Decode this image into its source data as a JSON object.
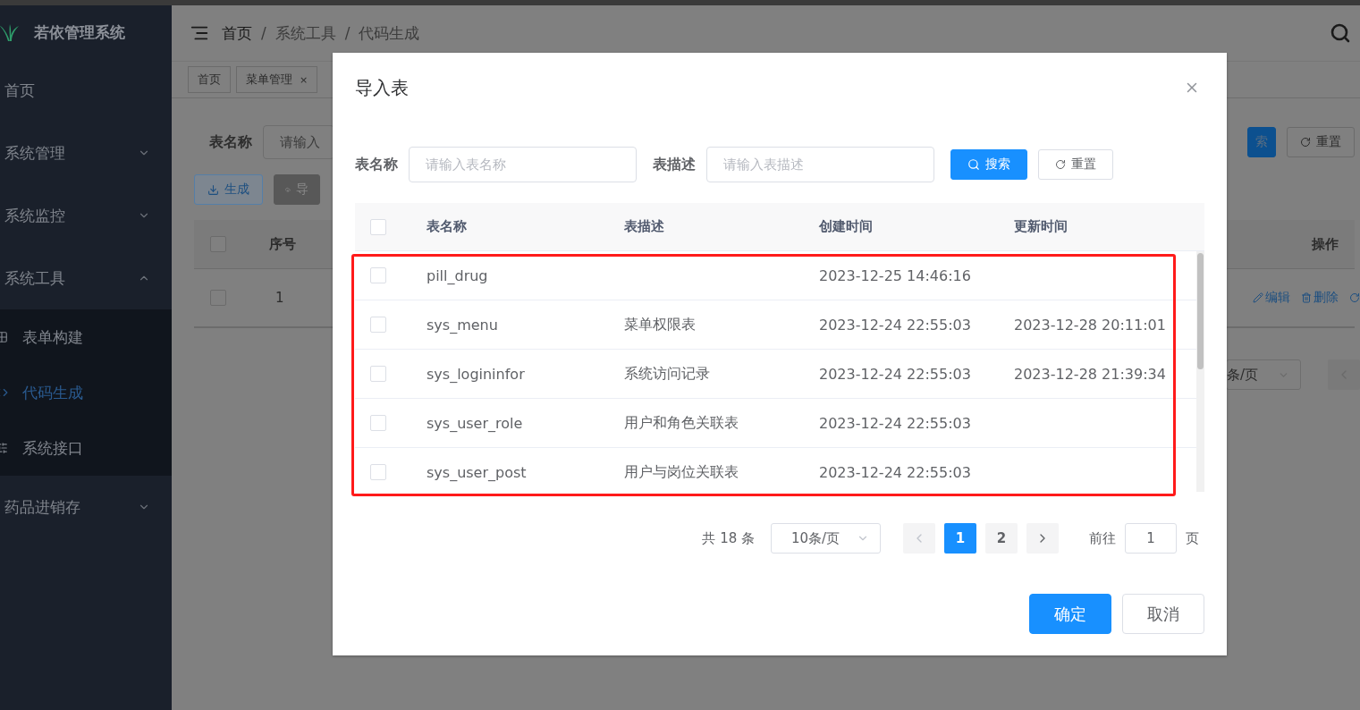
{
  "sidebar": {
    "title": "若依管理系统",
    "items": [
      {
        "label": "首页",
        "kind": "link"
      },
      {
        "label": "系统管理",
        "kind": "group",
        "expanded": false
      },
      {
        "label": "系统监控",
        "kind": "group",
        "expanded": false
      },
      {
        "label": "系统工具",
        "kind": "group",
        "expanded": true,
        "children": [
          {
            "label": "表单构建",
            "selected": false
          },
          {
            "label": "代码生成",
            "selected": true
          },
          {
            "label": "系统接口",
            "selected": false
          }
        ]
      },
      {
        "label": "药品进销存",
        "kind": "group",
        "expanded": false
      }
    ]
  },
  "header": {
    "breadcrumb": [
      "首页",
      "系统工具",
      "代码生成"
    ],
    "separator": "/"
  },
  "tags": [
    {
      "label": "首页"
    },
    {
      "label": "菜单管理",
      "close": "×"
    }
  ],
  "page": {
    "search_label": "表名称",
    "search_placeholder": "请输入",
    "search_button": "索",
    "reset_button": "重置",
    "generate_button": "生成",
    "import_button": "导",
    "columns": [
      "序号",
      "操作"
    ],
    "all_checked": false,
    "row": {
      "checked": false,
      "index": "1",
      "actions": [
        "编辑",
        "删除"
      ]
    },
    "page_size": "条/页"
  },
  "dialog": {
    "title": "导入表",
    "filters": [
      {
        "label": "表名称",
        "placeholder": "请输入表名称"
      },
      {
        "label": "表描述",
        "placeholder": "请输入表描述"
      }
    ],
    "search_button": "搜索",
    "reset_button": "重置",
    "columns": [
      "表名称",
      "表描述",
      "创建时间",
      "更新时间"
    ],
    "all_checked": false,
    "rows": [
      {
        "name": "pill_drug",
        "description": "",
        "created": "2023-12-25 14:46:16",
        "updated": "",
        "checked": false
      },
      {
        "name": "sys_menu",
        "description": "菜单权限表",
        "created": "2023-12-24 22:55:03",
        "updated": "2023-12-28 20:11:01",
        "checked": false
      },
      {
        "name": "sys_logininfor",
        "description": "系统访问记录",
        "created": "2023-12-24 22:55:03",
        "updated": "2023-12-28 21:39:34",
        "checked": false
      },
      {
        "name": "sys_user_role",
        "description": "用户和角色关联表",
        "created": "2023-12-24 22:55:03",
        "updated": "",
        "checked": false
      },
      {
        "name": "sys_user_post",
        "description": "用户与岗位关联表",
        "created": "2023-12-24 22:55:03",
        "updated": "",
        "checked": false
      }
    ],
    "pagination": {
      "total": "共 18 条",
      "page_size": "10条/页",
      "pages": [
        {
          "label": "1",
          "selected": true
        },
        {
          "label": "2",
          "selected": false
        }
      ],
      "goto_label": "前往",
      "goto_value": "1",
      "goto_suffix": "页"
    },
    "confirm_button": "确定",
    "cancel_button": "取消"
  }
}
